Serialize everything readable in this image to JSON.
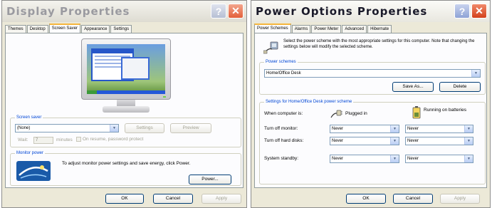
{
  "display": {
    "title": "Display Properties",
    "tabs": [
      "Themes",
      "Desktop",
      "Screen Saver",
      "Appearance",
      "Settings"
    ],
    "active_tab": 2,
    "screen_saver": {
      "group_label": "Screen saver",
      "selected": "(None)",
      "settings_label": "Settings",
      "preview_label": "Preview",
      "wait_label": "Wait:",
      "wait_value": "7",
      "minutes_label": "minutes",
      "on_resume_label": "On resume, password protect"
    },
    "monitor_power": {
      "group_label": "Monitor power",
      "text": "To adjust monitor power settings and save energy, click Power.",
      "power_button": "Power..."
    },
    "footer": {
      "ok": "OK",
      "cancel": "Cancel",
      "apply": "Apply"
    }
  },
  "power": {
    "title": "Power Options Properties",
    "tabs": [
      "Power Schemes",
      "Alarms",
      "Power Meter",
      "Advanced",
      "Hibernate"
    ],
    "active_tab": 0,
    "intro": "Select the power scheme with the most appropriate settings for this computer. Note that changing the settings below will modify the selected scheme.",
    "schemes": {
      "group_label": "Power schemes",
      "selected": "Home/Office Desk",
      "save_as": "Save As...",
      "delete": "Delete"
    },
    "settings": {
      "group_label": "Settings for Home/Office Desk power scheme",
      "when_label": "When computer is:",
      "plugged_in": "Plugged in",
      "on_batteries": "Running on batteries",
      "rows": [
        {
          "label": "Turn off monitor:",
          "plugged": "Never",
          "battery": "Never"
        },
        {
          "label": "Turn off hard disks:",
          "plugged": "Never",
          "battery": "Never"
        },
        {
          "label": "System standby:",
          "plugged": "Never",
          "battery": "Never"
        }
      ]
    },
    "footer": {
      "ok": "OK",
      "cancel": "Cancel",
      "apply": "Apply"
    }
  },
  "colors": {
    "dialog_bg": "#ece9d8",
    "group_label": "#0046d5",
    "active_tab_accent": "#f5b53c",
    "close_button": "#d3401b"
  }
}
